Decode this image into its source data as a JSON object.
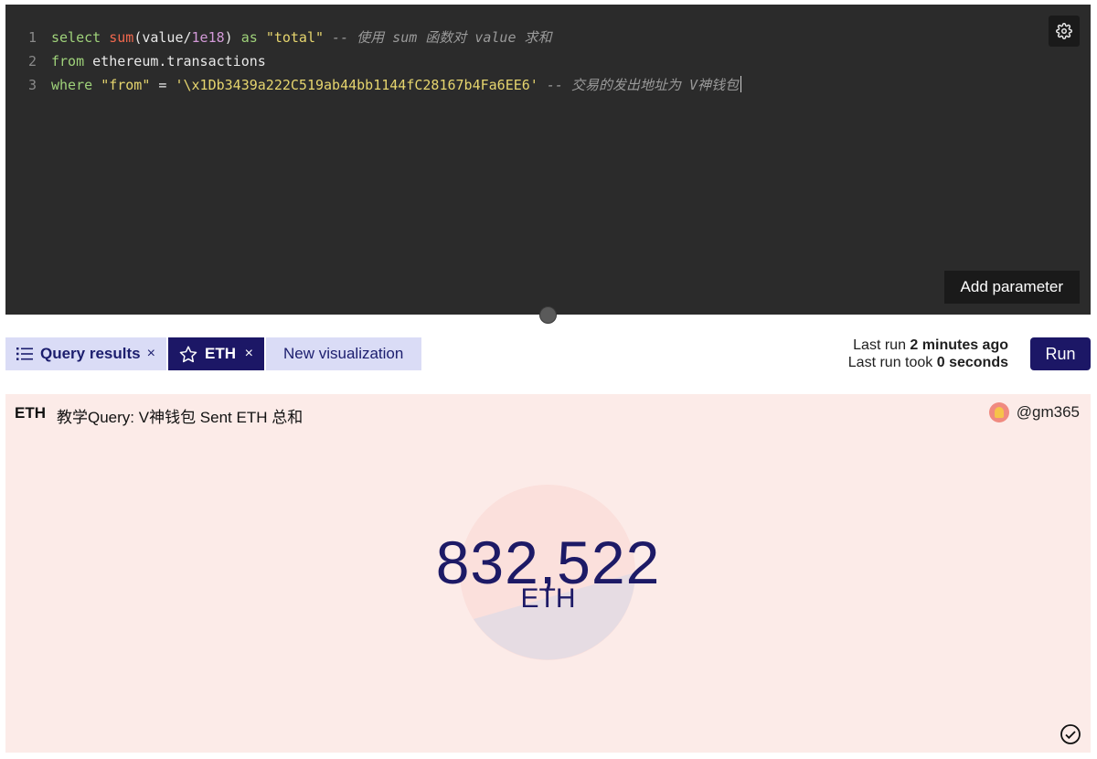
{
  "editor": {
    "lines": [
      {
        "num": "1",
        "tokens": [
          {
            "t": "kw",
            "v": "select "
          },
          {
            "t": "fn",
            "v": "sum"
          },
          {
            "t": "plain",
            "v": "(value/"
          },
          {
            "t": "num",
            "v": "1e18"
          },
          {
            "t": "plain",
            "v": ") "
          },
          {
            "t": "kw",
            "v": "as "
          },
          {
            "t": "str",
            "v": "\"total\""
          },
          {
            "t": "cmt",
            "v": " -- 使用 sum 函数对 value 求和"
          }
        ]
      },
      {
        "num": "2",
        "tokens": [
          {
            "t": "kw",
            "v": "from "
          },
          {
            "t": "plain",
            "v": "ethereum.transactions"
          }
        ]
      },
      {
        "num": "3",
        "tokens": [
          {
            "t": "kw",
            "v": "where "
          },
          {
            "t": "str",
            "v": "\"from\""
          },
          {
            "t": "plain",
            "v": " = "
          },
          {
            "t": "str",
            "v": "'\\x1Db3439a222C519ab44bb1144fC28167b4Fa6EE6'"
          },
          {
            "t": "cmt",
            "v": " -- 交易的发出地址为 V神钱包"
          }
        ]
      }
    ],
    "add_parameter_label": "Add parameter",
    "settings_icon": "gear-icon"
  },
  "tabs": {
    "results_label": "Query results",
    "eth_label": "ETH",
    "new_viz_label": "New visualization",
    "close_glyph": "×"
  },
  "run": {
    "last_run_prefix": "Last run ",
    "last_run_value": "2 minutes ago",
    "took_prefix": "Last run took ",
    "took_value": "0 seconds",
    "button_label": "Run"
  },
  "visualization": {
    "name": "ETH",
    "title": "教学Query: V神钱包 Sent ETH 总和",
    "author": "@gm365",
    "value": "832,522",
    "unit": "ETH"
  },
  "colors": {
    "editor_bg": "#2b2b2b",
    "brand_navy": "#1c1766",
    "tab_light": "#dadcf6",
    "panel_bg": "#fcebe8"
  }
}
